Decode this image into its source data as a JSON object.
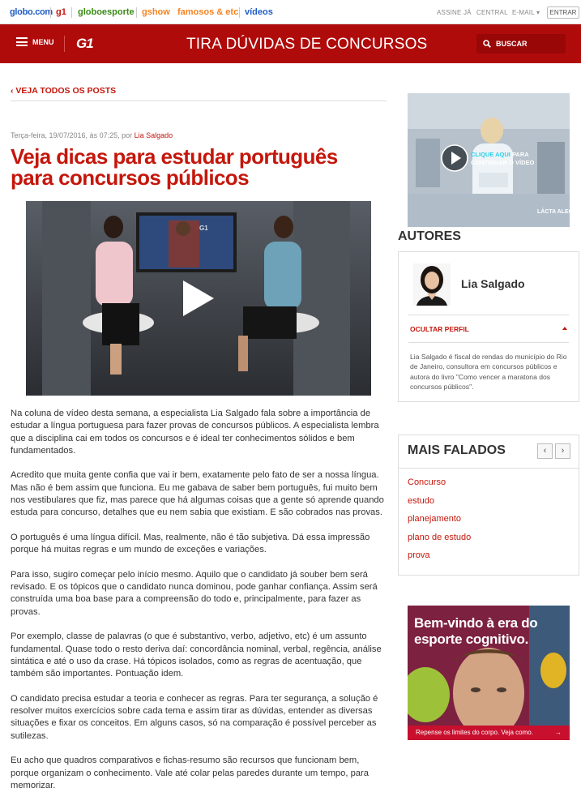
{
  "globobar": {
    "links": [
      "globo.com",
      "g1",
      "globoesporte",
      "gshow",
      "famosos & etc",
      "vídeos"
    ],
    "assine": "ASSINE JÁ",
    "central": "CENTRAL",
    "email": "E-MAIL",
    "entrar": "ENTRAR"
  },
  "header": {
    "menu_label": "MENU",
    "logo": "G1",
    "title": "TIRA DÚVIDAS DE CONCURSOS",
    "search_label": "BUSCAR"
  },
  "article": {
    "back_link": "VEJA TODOS OS POSTS",
    "date": "Terça-feira, 19/07/2016, às 07:25, por",
    "author": "Lia Salgado",
    "title": "Veja dicas para estudar português para concursos públicos",
    "video_overlay": "G1",
    "paragraphs": [
      "Na coluna de vídeo desta semana, a especialista Lia Salgado fala sobre a importância de estudar a língua portuguesa para fazer provas de concursos públicos. A especialista lembra que a disciplina cai em todos os concursos e é ideal ter conhecimentos sólidos e bem fundamentados.",
      "Acredito que muita gente confia que vai ir bem, exatamente pelo fato de ser a nossa língua. Mas não é bem assim que funciona. Eu me gabava de saber bem português, fui muito bem nos vestibulares que fiz, mas parece que há algumas coisas que a gente só aprende quando estuda para concurso, detalhes que eu nem sabia que existiam. E são cobrados nas provas.",
      "O português é uma língua difícil. Mas, realmente, não é tão subjetiva. Dá essa impressão porque há muitas regras e um mundo de exceções e variações.",
      "Para isso, sugiro começar pelo início mesmo. Aquilo que o candidato já souber bem será revisado. E os tópicos que o candidato nunca dominou, pode ganhar confiança. Assim será construída uma boa base para a compreensão do todo e, principalmente, para fazer as provas.",
      "Por exemplo, classe de palavras (o que é substantivo, verbo, adjetivo, etc) é um assunto fundamental. Quase todo o resto deriva daí: concordância nominal, verbal, regência, análise sintática e até o uso da crase. Há tópicos isolados, como as regras de acentuação, que também são importantes. Pontuação idem.",
      "O candidato precisa estudar a teoria e conhecer as regras.  Para ter segurança, a solução é resolver muitos exercícios sobre cada tema e assim tirar as dúvidas, entender as diversas situações e fixar os conceitos. Em alguns casos, só na comparação é possível perceber as sutilezas.",
      "Eu acho que quadros comparativos e fichas-resumo são recursos que funcionam bem, porque organizam o conhecimento. Vale até colar pelas paredes durante um tempo, para memorizar."
    ]
  },
  "promo": {
    "cta_highlight": "CLIQUE AQUI",
    "cta_rest": " PARA CONTINUAR O VÍDEO",
    "badge": "LÁCTA ALEGRIA"
  },
  "autores": {
    "heading": "AUTORES",
    "name": "Lia Salgado",
    "toggle": "OCULTAR PERFIL",
    "bio": "Lia Salgado é fiscal de rendas do município do Rio de Janeiro, consultora em concursos públicos e autora do livro \"Como vencer a maratona dos concursos públicos\"."
  },
  "mais_falados": {
    "heading": "MAIS FALADOS",
    "items": [
      "Concurso",
      "estudo",
      "planejamento",
      "plano de estudo",
      "prova"
    ]
  },
  "ad": {
    "headline": "Bem-vindo à era do esporte cognitivo.",
    "footer": "Repense os limites do corpo. Veja como.",
    "arrow": "→"
  },
  "colors": {
    "brand_red": "#c4170c",
    "header_red": "#b00b0b"
  }
}
